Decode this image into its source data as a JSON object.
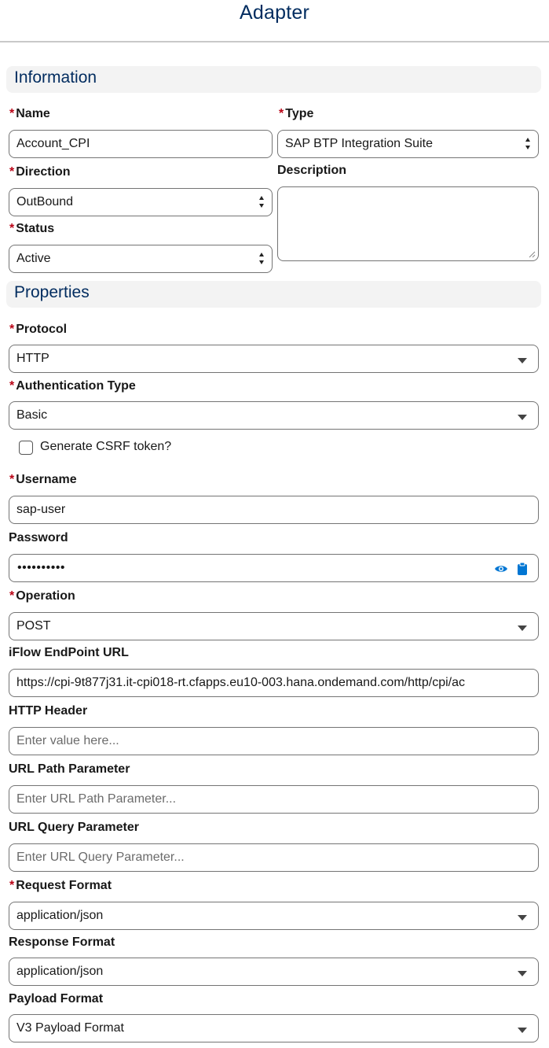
{
  "header": {
    "title": "Adapter"
  },
  "sections": {
    "information": "Information",
    "properties": "Properties"
  },
  "required_marker": "*",
  "fields": {
    "name": {
      "label": "Name",
      "value": "Account_CPI"
    },
    "type": {
      "label": "Type",
      "value": "SAP BTP Integration Suite"
    },
    "direction": {
      "label": "Direction",
      "value": "OutBound"
    },
    "description": {
      "label": "Description",
      "value": ""
    },
    "status": {
      "label": "Status",
      "value": "Active"
    },
    "protocol": {
      "label": "Protocol",
      "value": "HTTP"
    },
    "auth_type": {
      "label": "Authentication Type",
      "value": "Basic"
    },
    "csrf": {
      "label": "Generate CSRF token?",
      "checked": false
    },
    "username": {
      "label": "Username",
      "value": "sap-user"
    },
    "password": {
      "label": "Password",
      "masked": "••••••••••"
    },
    "operation": {
      "label": "Operation",
      "value": "POST"
    },
    "iflow_url": {
      "label": "iFlow EndPoint URL",
      "value": "https://cpi-9t877j31.it-cpi018-rt.cfapps.eu10-003.hana.ondemand.com/http/cpi/ac"
    },
    "http_header": {
      "label": "HTTP Header",
      "placeholder": "Enter value here..."
    },
    "url_path_param": {
      "label": "URL Path Parameter",
      "placeholder": "Enter URL Path Parameter..."
    },
    "url_query_param": {
      "label": "URL Query Parameter",
      "placeholder": "Enter URL Query Parameter..."
    },
    "request_format": {
      "label": "Request Format",
      "value": "application/json"
    },
    "response_format": {
      "label": "Response Format",
      "value": "application/json"
    },
    "payload_format": {
      "label": "Payload Format",
      "value": "V3 Payload Format"
    }
  },
  "icons": {
    "show_password": "eye-icon",
    "copy": "clipboard-icon"
  },
  "colors": {
    "title": "#032d60",
    "required": "#ba0517",
    "icon": "#0176d3",
    "section_bg": "#f3f3f3"
  }
}
